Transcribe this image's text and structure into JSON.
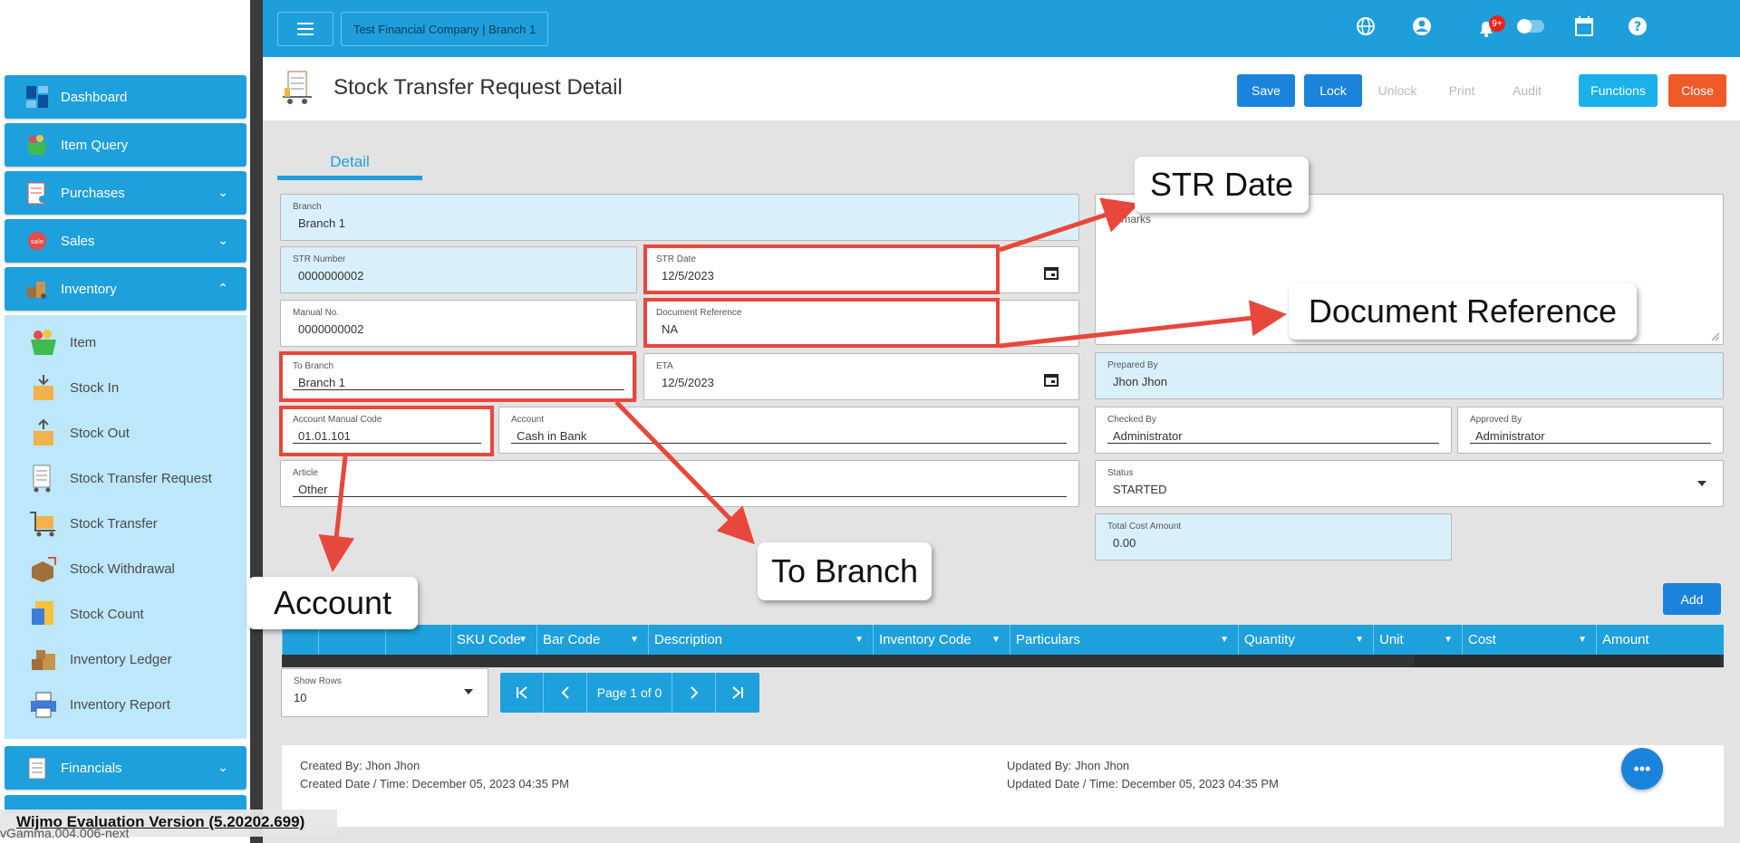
{
  "topbar": {
    "company": "Test Financial Company | Branch 1",
    "notification_badge": "9+"
  },
  "sidebar": {
    "items": [
      {
        "label": "Dashboard"
      },
      {
        "label": "Item Query"
      },
      {
        "label": "Purchases"
      },
      {
        "label": "Sales"
      },
      {
        "label": "Inventory"
      },
      {
        "label": "Financials"
      }
    ],
    "inventory_sub": [
      {
        "label": "Item"
      },
      {
        "label": "Stock In"
      },
      {
        "label": "Stock Out"
      },
      {
        "label": "Stock Transfer Request"
      },
      {
        "label": "Stock Transfer"
      },
      {
        "label": "Stock Withdrawal"
      },
      {
        "label": "Stock Count"
      },
      {
        "label": "Inventory Ledger"
      },
      {
        "label": "Inventory Report"
      }
    ]
  },
  "header": {
    "title": "Stock Transfer Request Detail",
    "buttons": {
      "save": "Save",
      "lock": "Lock",
      "unlock": "Unlock",
      "print": "Print",
      "audit": "Audit",
      "functions": "Functions",
      "close": "Close"
    }
  },
  "tabs": {
    "detail": "Detail"
  },
  "form": {
    "branch": {
      "label": "Branch",
      "value": "Branch 1"
    },
    "str_number": {
      "label": "STR Number",
      "value": "0000000002"
    },
    "str_date": {
      "label": "STR Date",
      "value": "12/5/2023"
    },
    "manual_no": {
      "label": "Manual No.",
      "value": "0000000002"
    },
    "document_reference": {
      "label": "Document Reference",
      "value": "NA"
    },
    "to_branch": {
      "label": "To Branch",
      "value": "Branch 1"
    },
    "eta": {
      "label": "ETA",
      "value": "12/5/2023"
    },
    "account_manual_code": {
      "label": "Account Manual Code",
      "value": "01.01.101"
    },
    "account": {
      "label": "Account",
      "value": "Cash in Bank"
    },
    "article": {
      "label": "Article",
      "value": "Other"
    },
    "remarks": {
      "label": "Remarks",
      "value": ""
    },
    "prepared_by": {
      "label": "Prepared By",
      "value": "Jhon Jhon"
    },
    "checked_by": {
      "label": "Checked By",
      "value": "Administrator"
    },
    "approved_by": {
      "label": "Approved By",
      "value": "Administrator"
    },
    "status": {
      "label": "Status",
      "value": "STARTED"
    },
    "total_cost_amount": {
      "label": "Total Cost Amount",
      "value": "0.00"
    }
  },
  "grid": {
    "add_label": "Add",
    "columns": [
      "SKU Code",
      "Bar Code",
      "Description",
      "Inventory Code",
      "Particulars",
      "Quantity",
      "Unit",
      "Cost",
      "Amount"
    ]
  },
  "pager": {
    "show_rows_label": "Show Rows",
    "show_rows_value": "10",
    "page_text": "Page 1 of 0"
  },
  "footer": {
    "created_by": "Created By: Jhon Jhon",
    "created_date": "Created Date / Time: December 05, 2023 04:35 PM",
    "updated_by": "Updated By: Jhon Jhon",
    "updated_date": "Updated Date / Time: December 05, 2023 04:35 PM"
  },
  "annotations": {
    "str_date": "STR Date",
    "document_reference": "Document Reference",
    "to_branch": "To Branch",
    "account": "Account"
  },
  "watermark": {
    "wijmo": "Wijmo Evaluation Version (5.20202.699)",
    "version": "vGamma.004.006-next"
  },
  "colors": {
    "primary": "#1e9fdc",
    "save": "#1a84dc",
    "close": "#f05a28",
    "highlight": "#e8473c"
  }
}
